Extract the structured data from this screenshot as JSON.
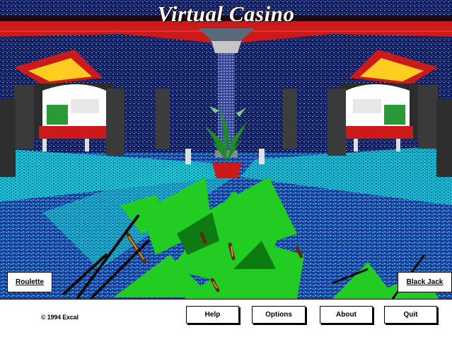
{
  "window": {
    "title": "Virtual Casino"
  },
  "scene": {
    "description_icon": "casino-lobby-scene",
    "left_button_label": "Roulette",
    "right_button_label": "Black Jack"
  },
  "footer": {
    "copyright": "© 1994 Excal",
    "buttons": {
      "help": "Help",
      "options": "Options",
      "about": "About",
      "quit": "Quit"
    }
  },
  "colors": {
    "title_text": "#ffffff",
    "ceiling_red": "#cc1a1a",
    "floor_blue": "#1a4fb3",
    "floor_cyan": "#1fc6d6",
    "plant_green": "#22cc22",
    "panel_bg": "#ffffff"
  }
}
